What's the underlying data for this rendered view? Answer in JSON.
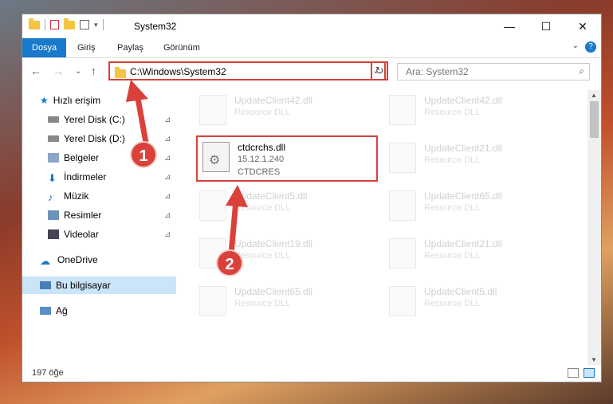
{
  "window": {
    "title": "System32",
    "minimize": "—",
    "maximize": "☐",
    "close": "✕"
  },
  "ribbon": {
    "tabs": [
      "Dosya",
      "Giriş",
      "Paylaş",
      "Görünüm"
    ],
    "help": "?",
    "expand": "⌄"
  },
  "nav": {
    "back": "←",
    "forward": "→",
    "recent": "⌄",
    "up": "↑",
    "address": "C:\\Windows\\System32",
    "address_dropdown": "⌄",
    "refresh": "↻",
    "search_placeholder": "Ara: System32",
    "search_icon": "⌕"
  },
  "sidebar": {
    "quick_access": "Hızlı erişim",
    "items": [
      {
        "label": "Yerel Disk (C:)",
        "icon": "drive-icon"
      },
      {
        "label": "Yerel Disk (D:)",
        "icon": "drive-icon"
      },
      {
        "label": "Belgeler",
        "icon": "documents-icon"
      },
      {
        "label": "İndirmeler",
        "icon": "downloads-icon"
      },
      {
        "label": "Müzik",
        "icon": "music-icon"
      },
      {
        "label": "Resimler",
        "icon": "pictures-icon"
      },
      {
        "label": "Videolar",
        "icon": "videos-icon"
      }
    ],
    "onedrive": "OneDrive",
    "this_pc": "Bu bilgisayar",
    "network": "Ağ",
    "pin": "📌"
  },
  "files": {
    "left": [
      {
        "name": "UpdateClient42.dll",
        "desc": "Resource DLL"
      },
      {
        "name": "ctdcrchs.dll",
        "desc": "15.12.1.240",
        "desc2": "CTDCRES"
      },
      {
        "name": "UpdateClient5.dll",
        "desc": "Resource DLL"
      },
      {
        "name": "UpdateClient19.dll",
        "desc": "Resource DLL"
      },
      {
        "name": "UpdateClient65.dll",
        "desc": "Resource DLL"
      }
    ],
    "right": [
      {
        "name": "UpdateClient42.dll",
        "desc": "Resource DLL"
      },
      {
        "name": "UpdateClient21.dll",
        "desc": "Resource DLL"
      },
      {
        "name": "UpdateClient65.dll",
        "desc": "Resource DLL"
      },
      {
        "name": "UpdateClient21.dll",
        "desc": "Resource DLL"
      },
      {
        "name": "UpdateClient5.dll",
        "desc": "Resource DLL"
      }
    ]
  },
  "status": {
    "count": "197 öğe"
  },
  "callouts": {
    "one": "1",
    "two": "2",
    "color": "#d9413a"
  }
}
